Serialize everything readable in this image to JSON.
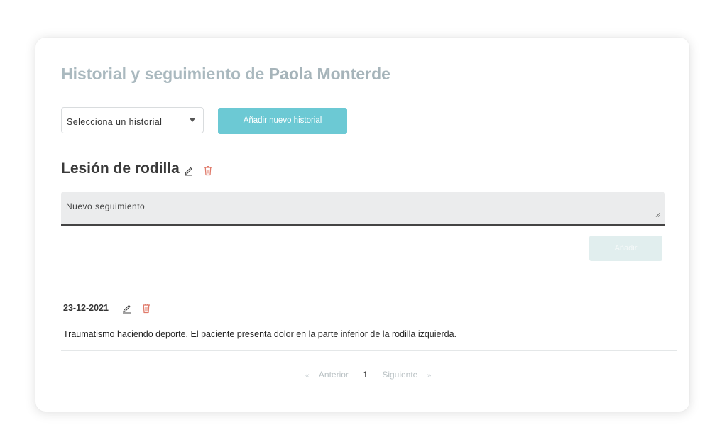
{
  "header": {
    "title_prefix": "Historial y seguimiento de ",
    "patient_name": "Paola Monterde"
  },
  "history_select": {
    "placeholder": "Selecciona un historial"
  },
  "buttons": {
    "add_history": "Añadir nuevo historial",
    "add_followup": "Añadir"
  },
  "history": {
    "title": "Lesión de rodilla"
  },
  "new_followup": {
    "label": "Nuevo seguimiento"
  },
  "entries": [
    {
      "date": "23-12-2021",
      "text": "Traumatismo haciendo deporte. El paciente presenta dolor en la parte inferior de la rodilla izquierda."
    }
  ],
  "pagination": {
    "prev_arrow": "«",
    "prev": "Anterior",
    "current": "1",
    "next": "Siguiente",
    "next_arrow": "»"
  },
  "colors": {
    "accent": "#6cc9d4",
    "delete_icon": "#e07a6a",
    "title_muted": "#aab9bf"
  },
  "icons": {
    "edit": "pencil-icon",
    "delete": "trash-icon",
    "dropdown": "caret-down-icon",
    "resize": "resize-handle-icon"
  }
}
